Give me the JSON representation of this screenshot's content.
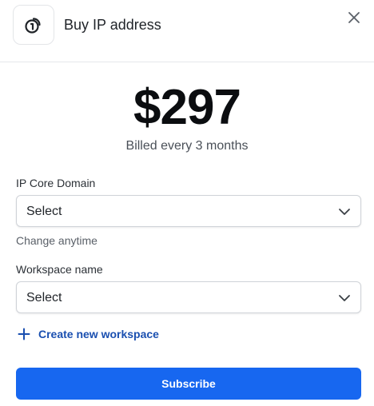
{
  "header": {
    "title": "Buy IP address",
    "icon": "ip-address-icon",
    "close_icon": "close-icon"
  },
  "pricing": {
    "amount": "$297",
    "billing_period": "Billed every 3 months"
  },
  "ip_core_domain": {
    "label": "IP Core Domain",
    "value": "Select",
    "helper": "Change anytime"
  },
  "workspace": {
    "label": "Workspace name",
    "value": "Select"
  },
  "create_workspace": {
    "label": "Create new workspace",
    "icon": "plus-icon"
  },
  "subscribe": {
    "label": "Subscribe"
  },
  "colors": {
    "primary": "#1767f0",
    "link": "#1a4fb0",
    "border": "#cfd3d8"
  }
}
